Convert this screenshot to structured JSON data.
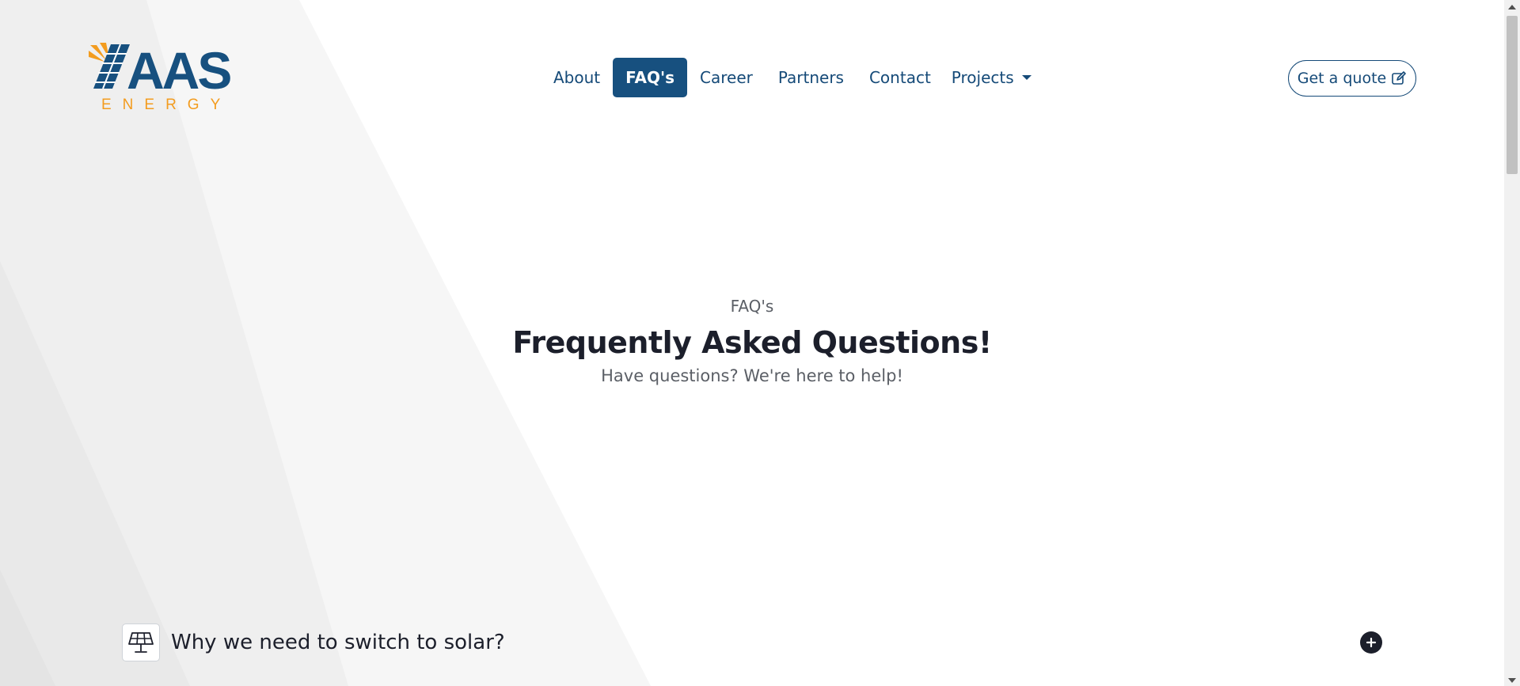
{
  "brand": {
    "logo_main": "AAS",
    "logo_sub": "ENERGY"
  },
  "nav": {
    "items": [
      {
        "label": "About"
      },
      {
        "label": "FAQ's"
      },
      {
        "label": "Career"
      },
      {
        "label": "Partners"
      },
      {
        "label": "Contact"
      },
      {
        "label": "Projects"
      }
    ],
    "active": "FAQ's"
  },
  "cta": {
    "label": "Get a quote",
    "icon": "edit-icon"
  },
  "hero": {
    "eyebrow": "FAQ's",
    "title": "Frequently Asked Questions!",
    "subtitle": "Have questions? We're here to help!"
  },
  "faq": {
    "items": [
      {
        "question": "Why we need to switch to solar?",
        "icon": "solar-panel-icon",
        "toggle_icon": "plus-circle-icon"
      }
    ]
  },
  "colors": {
    "primary": "#17507f",
    "accent": "#f39c1f",
    "text_dark": "#1c1f2b",
    "text_muted": "#5b5f66"
  }
}
